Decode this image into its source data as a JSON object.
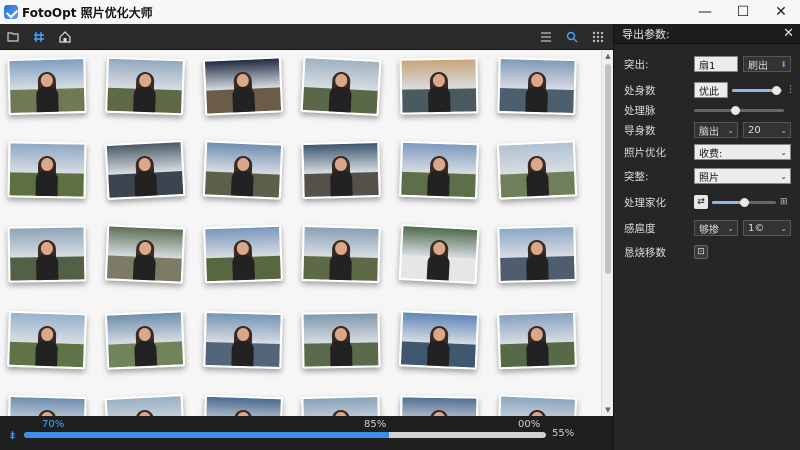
{
  "app": {
    "title": "FotoOpt 照片优化大师",
    "controls": {
      "minimize": "—",
      "maximize": "☐",
      "close": "✕"
    }
  },
  "toolbar": {
    "left_icons": [
      "folder-icon",
      "grid-icon",
      "home-icon"
    ],
    "right_icons": [
      "list-view-icon",
      "search-view-icon",
      "more-grid-icon"
    ]
  },
  "gallery": {
    "rows": 5,
    "cols": 6,
    "thumbs": [
      {
        "sky": "#7f9fc2",
        "ground": "#6f7a55",
        "person": true
      },
      {
        "sky": "#93a9c0",
        "ground": "#5e6a45",
        "person": true
      },
      {
        "sky": "#1f2b40",
        "ground": "#6b5c4a",
        "person": true
      },
      {
        "sky": "#9fb2c0",
        "ground": "#5b6848",
        "person": true
      },
      {
        "sky": "#c9a579",
        "ground": "#4b5a5e",
        "person": true
      },
      {
        "sky": "#7f9ab8",
        "ground": "#4d5f6e",
        "person": true
      },
      {
        "sky": "#8fa8c4",
        "ground": "#5f7040",
        "person": true
      },
      {
        "sky": "#4a5a66",
        "ground": "#3a4550",
        "person": true
      },
      {
        "sky": "#6f8fb0",
        "ground": "#5d5f4d",
        "person": true
      },
      {
        "sky": "#3d5670",
        "ground": "#54504a",
        "person": true
      },
      {
        "sky": "#7d9ac0",
        "ground": "#5e6e4a",
        "person": true
      },
      {
        "sky": "#b0c2d2",
        "ground": "#6f7f5a",
        "person": true
      },
      {
        "sky": "#8ea5b8",
        "ground": "#536045",
        "person": true
      },
      {
        "sky": "#5e6f53",
        "ground": "#7d7a66",
        "person": true
      },
      {
        "sky": "#7997bb",
        "ground": "#58673f",
        "person": true
      },
      {
        "sky": "#8aa0b5",
        "ground": "#5e6a45",
        "person": true
      },
      {
        "sky": "#4f6b4d",
        "ground": "#e6e6e6",
        "person": true
      },
      {
        "sky": "#8ca7c6",
        "ground": "#4e5e70",
        "person": true
      },
      {
        "sky": "#97b1cc",
        "ground": "#5f7446",
        "person": true
      },
      {
        "sky": "#6f8fae",
        "ground": "#70845a",
        "person": true
      },
      {
        "sky": "#7594b5",
        "ground": "#54657a",
        "person": true
      },
      {
        "sky": "#8098ad",
        "ground": "#5a6a4a",
        "person": true
      },
      {
        "sky": "#5e86b8",
        "ground": "#3f5870",
        "person": true
      },
      {
        "sky": "#86a1bf",
        "ground": "#566a48",
        "person": true
      },
      {
        "sky": "#6f8db0",
        "ground": "#586a4c",
        "person": true
      },
      {
        "sky": "#9ab0c4",
        "ground": "#5e6e4b",
        "person": true
      },
      {
        "sky": "#4a6a90",
        "ground": "#4c5d6b",
        "person": true
      },
      {
        "sky": "#8aa2b8",
        "ground": "#5c6c4a",
        "person": true
      },
      {
        "sky": "#526f94",
        "ground": "#4b5a70",
        "person": true
      },
      {
        "sky": "#8da6be",
        "ground": "#5e6e4c",
        "person": true
      }
    ]
  },
  "progress": {
    "fill": 0.7,
    "label_left": "70%",
    "label_mid": "85%",
    "label_right_top": "00%",
    "label_right": "55%"
  },
  "panel": {
    "title": "导出参数:",
    "close": "✕",
    "rows": [
      {
        "label": "突出:",
        "field1": "扇1",
        "field2": "刷出"
      },
      {
        "label": "处身数",
        "field1": "优此"
      },
      {
        "label": "处理脉"
      },
      {
        "label": "导身数",
        "field1": "脑出",
        "field2": "20"
      },
      {
        "label": "照片优化",
        "field1": "收费:"
      },
      {
        "label": "突整:",
        "field1": "照片"
      },
      {
        "label": "处理家化"
      },
      {
        "label": "感扈度",
        "field1": "够掺",
        "field2": "1©"
      },
      {
        "label": "恳烧移数"
      }
    ],
    "sliders": {
      "row2": 0.88,
      "row3": 0.45,
      "row7": 0.5
    }
  }
}
